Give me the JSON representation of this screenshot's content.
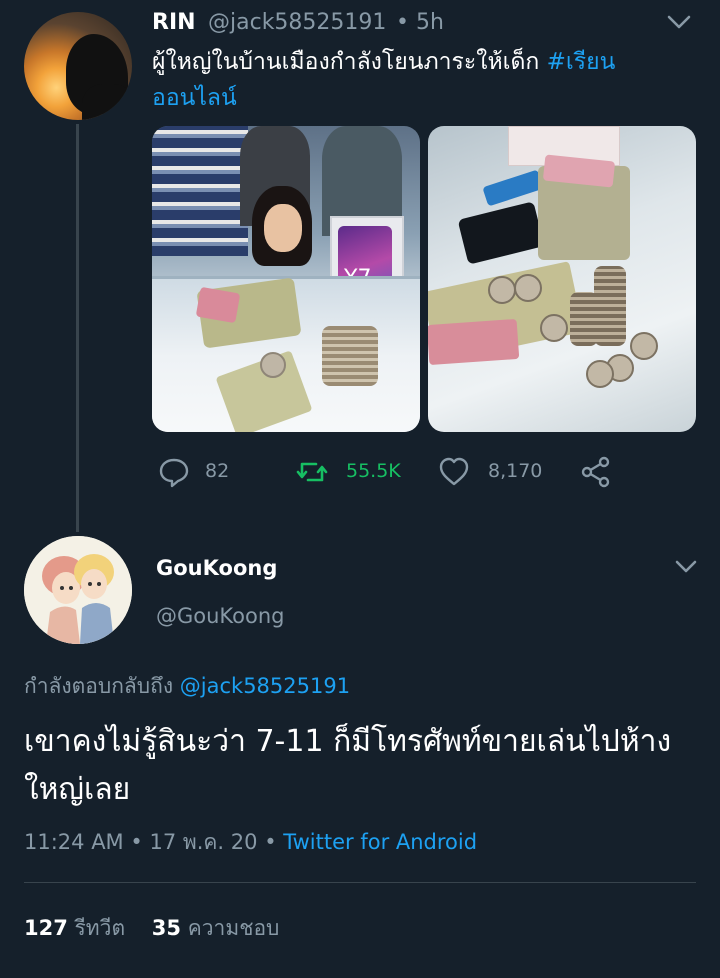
{
  "parent_tweet": {
    "display_name": "RIN",
    "handle": "@jack58525191",
    "separator": "•",
    "time_ago": "5h",
    "text_main": "ผู้ใหญ่ในบ้านเมืองกำลังโยนภาระให้เด็ก ",
    "hashtag": "#เรียนออนไลน์",
    "photos": [
      {
        "icon": "photo-phone-store-girl",
        "phone_model": "Y7"
      },
      {
        "icon": "photo-money-coins"
      }
    ],
    "actions": {
      "replies": "82",
      "retweets": "55.5K",
      "likes": "8,170"
    },
    "colors": {
      "retweet": "#17bf63",
      "link": "#1da1f2"
    }
  },
  "reply_tweet": {
    "display_name": "GouKoong",
    "handle": "@GouKoong",
    "replying_to_label": "กำลังตอบกลับถึง ",
    "replying_to_handle": "@jack58525191",
    "text": "เขาคงไม่รู้สินะว่า 7-11 ก็มีโทรศัพท์ขายเล่นไปห้างใหญ่เลย",
    "time": "11:24 AM",
    "separator": "•",
    "date": "17 พ.ค. 20",
    "source": "Twitter for Android",
    "stats": {
      "retweets_count": "127",
      "retweets_label": "รีทวีต",
      "likes_count": "35",
      "likes_label": "ความชอบ"
    }
  },
  "theme": {
    "background": "#15202b",
    "muted": "#8899a6",
    "divider": "#38444d"
  }
}
